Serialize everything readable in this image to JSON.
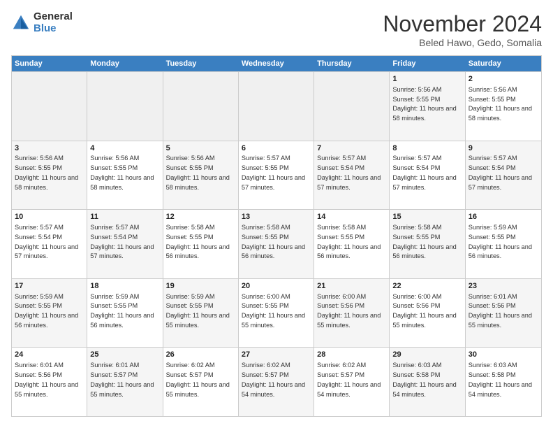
{
  "logo": {
    "general": "General",
    "blue": "Blue"
  },
  "title": "November 2024",
  "location": "Beled Hawo, Gedo, Somalia",
  "weekdays": [
    "Sunday",
    "Monday",
    "Tuesday",
    "Wednesday",
    "Thursday",
    "Friday",
    "Saturday"
  ],
  "rows": [
    [
      {
        "day": "",
        "info": "",
        "empty": true
      },
      {
        "day": "",
        "info": "",
        "empty": true
      },
      {
        "day": "",
        "info": "",
        "empty": true
      },
      {
        "day": "",
        "info": "",
        "empty": true
      },
      {
        "day": "",
        "info": "",
        "empty": true
      },
      {
        "day": "1",
        "info": "Sunrise: 5:56 AM\nSunset: 5:55 PM\nDaylight: 11 hours and 58 minutes.",
        "shaded": true
      },
      {
        "day": "2",
        "info": "Sunrise: 5:56 AM\nSunset: 5:55 PM\nDaylight: 11 hours and 58 minutes.",
        "shaded": false
      }
    ],
    [
      {
        "day": "3",
        "info": "Sunrise: 5:56 AM\nSunset: 5:55 PM\nDaylight: 11 hours and 58 minutes.",
        "shaded": true
      },
      {
        "day": "4",
        "info": "Sunrise: 5:56 AM\nSunset: 5:55 PM\nDaylight: 11 hours and 58 minutes.",
        "shaded": false
      },
      {
        "day": "5",
        "info": "Sunrise: 5:56 AM\nSunset: 5:55 PM\nDaylight: 11 hours and 58 minutes.",
        "shaded": true
      },
      {
        "day": "6",
        "info": "Sunrise: 5:57 AM\nSunset: 5:55 PM\nDaylight: 11 hours and 57 minutes.",
        "shaded": false
      },
      {
        "day": "7",
        "info": "Sunrise: 5:57 AM\nSunset: 5:54 PM\nDaylight: 11 hours and 57 minutes.",
        "shaded": true
      },
      {
        "day": "8",
        "info": "Sunrise: 5:57 AM\nSunset: 5:54 PM\nDaylight: 11 hours and 57 minutes.",
        "shaded": false
      },
      {
        "day": "9",
        "info": "Sunrise: 5:57 AM\nSunset: 5:54 PM\nDaylight: 11 hours and 57 minutes.",
        "shaded": true
      }
    ],
    [
      {
        "day": "10",
        "info": "Sunrise: 5:57 AM\nSunset: 5:54 PM\nDaylight: 11 hours and 57 minutes.",
        "shaded": false
      },
      {
        "day": "11",
        "info": "Sunrise: 5:57 AM\nSunset: 5:54 PM\nDaylight: 11 hours and 57 minutes.",
        "shaded": true
      },
      {
        "day": "12",
        "info": "Sunrise: 5:58 AM\nSunset: 5:55 PM\nDaylight: 11 hours and 56 minutes.",
        "shaded": false
      },
      {
        "day": "13",
        "info": "Sunrise: 5:58 AM\nSunset: 5:55 PM\nDaylight: 11 hours and 56 minutes.",
        "shaded": true
      },
      {
        "day": "14",
        "info": "Sunrise: 5:58 AM\nSunset: 5:55 PM\nDaylight: 11 hours and 56 minutes.",
        "shaded": false
      },
      {
        "day": "15",
        "info": "Sunrise: 5:58 AM\nSunset: 5:55 PM\nDaylight: 11 hours and 56 minutes.",
        "shaded": true
      },
      {
        "day": "16",
        "info": "Sunrise: 5:59 AM\nSunset: 5:55 PM\nDaylight: 11 hours and 56 minutes.",
        "shaded": false
      }
    ],
    [
      {
        "day": "17",
        "info": "Sunrise: 5:59 AM\nSunset: 5:55 PM\nDaylight: 11 hours and 56 minutes.",
        "shaded": true
      },
      {
        "day": "18",
        "info": "Sunrise: 5:59 AM\nSunset: 5:55 PM\nDaylight: 11 hours and 56 minutes.",
        "shaded": false
      },
      {
        "day": "19",
        "info": "Sunrise: 5:59 AM\nSunset: 5:55 PM\nDaylight: 11 hours and 55 minutes.",
        "shaded": true
      },
      {
        "day": "20",
        "info": "Sunrise: 6:00 AM\nSunset: 5:55 PM\nDaylight: 11 hours and 55 minutes.",
        "shaded": false
      },
      {
        "day": "21",
        "info": "Sunrise: 6:00 AM\nSunset: 5:56 PM\nDaylight: 11 hours and 55 minutes.",
        "shaded": true
      },
      {
        "day": "22",
        "info": "Sunrise: 6:00 AM\nSunset: 5:56 PM\nDaylight: 11 hours and 55 minutes.",
        "shaded": false
      },
      {
        "day": "23",
        "info": "Sunrise: 6:01 AM\nSunset: 5:56 PM\nDaylight: 11 hours and 55 minutes.",
        "shaded": true
      }
    ],
    [
      {
        "day": "24",
        "info": "Sunrise: 6:01 AM\nSunset: 5:56 PM\nDaylight: 11 hours and 55 minutes.",
        "shaded": false
      },
      {
        "day": "25",
        "info": "Sunrise: 6:01 AM\nSunset: 5:57 PM\nDaylight: 11 hours and 55 minutes.",
        "shaded": true
      },
      {
        "day": "26",
        "info": "Sunrise: 6:02 AM\nSunset: 5:57 PM\nDaylight: 11 hours and 55 minutes.",
        "shaded": false
      },
      {
        "day": "27",
        "info": "Sunrise: 6:02 AM\nSunset: 5:57 PM\nDaylight: 11 hours and 54 minutes.",
        "shaded": true
      },
      {
        "day": "28",
        "info": "Sunrise: 6:02 AM\nSunset: 5:57 PM\nDaylight: 11 hours and 54 minutes.",
        "shaded": false
      },
      {
        "day": "29",
        "info": "Sunrise: 6:03 AM\nSunset: 5:58 PM\nDaylight: 11 hours and 54 minutes.",
        "shaded": true
      },
      {
        "day": "30",
        "info": "Sunrise: 6:03 AM\nSunset: 5:58 PM\nDaylight: 11 hours and 54 minutes.",
        "shaded": false
      }
    ]
  ]
}
